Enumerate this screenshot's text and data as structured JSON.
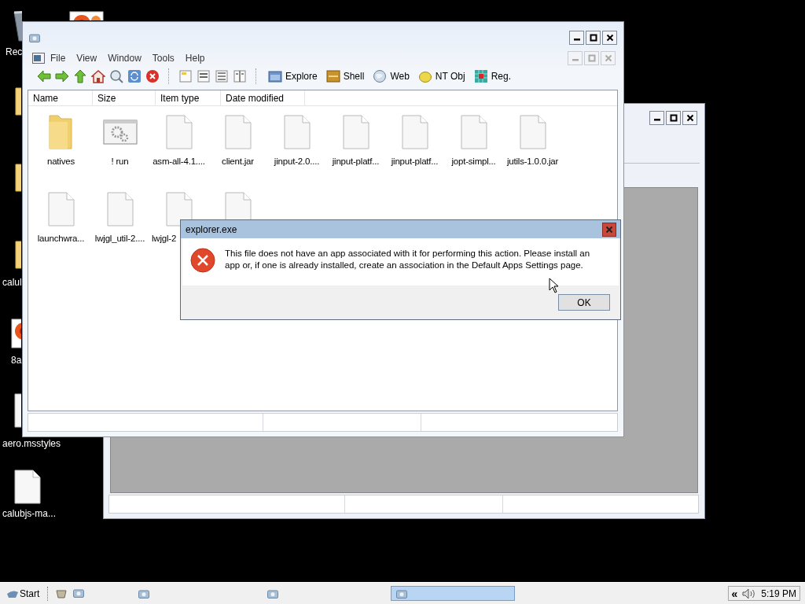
{
  "desktop_icons": [
    {
      "kind": "recycle",
      "label": "Rec"
    },
    {
      "kind": "photo"
    },
    {
      "kind": "folder"
    },
    {
      "kind": "folder"
    },
    {
      "kind": "folder",
      "label": "calul"
    },
    {
      "kind": "photo",
      "label": "8a"
    },
    {
      "kind": "file",
      "label": "aero.msstyles"
    },
    {
      "kind": "file",
      "label": "calubjs-ma..."
    }
  ],
  "main_window": {
    "menu": [
      "File",
      "View",
      "Window",
      "Tools",
      "Help"
    ],
    "toolbar": [
      {
        "kind": "back"
      },
      {
        "kind": "forward"
      },
      {
        "kind": "up"
      },
      {
        "kind": "home"
      },
      {
        "kind": "search"
      },
      {
        "kind": "refresh"
      },
      {
        "kind": "stop"
      },
      {
        "kind": "sep"
      },
      {
        "kind": "view1"
      },
      {
        "kind": "view2"
      },
      {
        "kind": "view3"
      },
      {
        "kind": "view4"
      },
      {
        "kind": "sep"
      },
      {
        "kind": "explore",
        "label": "Explore"
      },
      {
        "kind": "shell",
        "label": "Shell"
      },
      {
        "kind": "web",
        "label": "Web"
      },
      {
        "kind": "ntobj",
        "label": "NT Obj"
      },
      {
        "kind": "reg",
        "label": "Reg."
      }
    ],
    "columns": [
      "Name",
      "Size",
      "Item type",
      "Date modified"
    ],
    "items": [
      {
        "kind": "folder",
        "name": "natives"
      },
      {
        "kind": "app",
        "name": "! run"
      },
      {
        "kind": "file",
        "name": "asm-all-4.1...."
      },
      {
        "kind": "file",
        "name": "client.jar"
      },
      {
        "kind": "file",
        "name": "jinput-2.0...."
      },
      {
        "kind": "file",
        "name": "jinput-platf..."
      },
      {
        "kind": "file",
        "name": "jinput-platf..."
      },
      {
        "kind": "file",
        "name": "jopt-simpl..."
      },
      {
        "kind": "file",
        "name": "jutils-1.0.0.jar"
      },
      {
        "kind": "file",
        "name": "launchwra..."
      },
      {
        "kind": "file",
        "name": "lwjgl_util-2...."
      },
      {
        "kind": "file",
        "name": "lwjgl-2"
      },
      {
        "kind": "file"
      }
    ]
  },
  "dialog": {
    "title": "explorer.exe",
    "message": "This file does not have an app associated with it for performing this action. Please install an app or, if one is already installed, create an association in the Default Apps Settings page.",
    "button": "OK"
  },
  "taskbar": {
    "start": "Start",
    "quick_launch": [
      {
        "kind": "desktop"
      },
      {
        "kind": "window"
      }
    ],
    "tasks": [
      {
        "selected": false
      },
      {
        "selected": false
      },
      {
        "selected": true
      }
    ],
    "tray": {
      "expand": "«",
      "time": "5:19 PM"
    }
  }
}
